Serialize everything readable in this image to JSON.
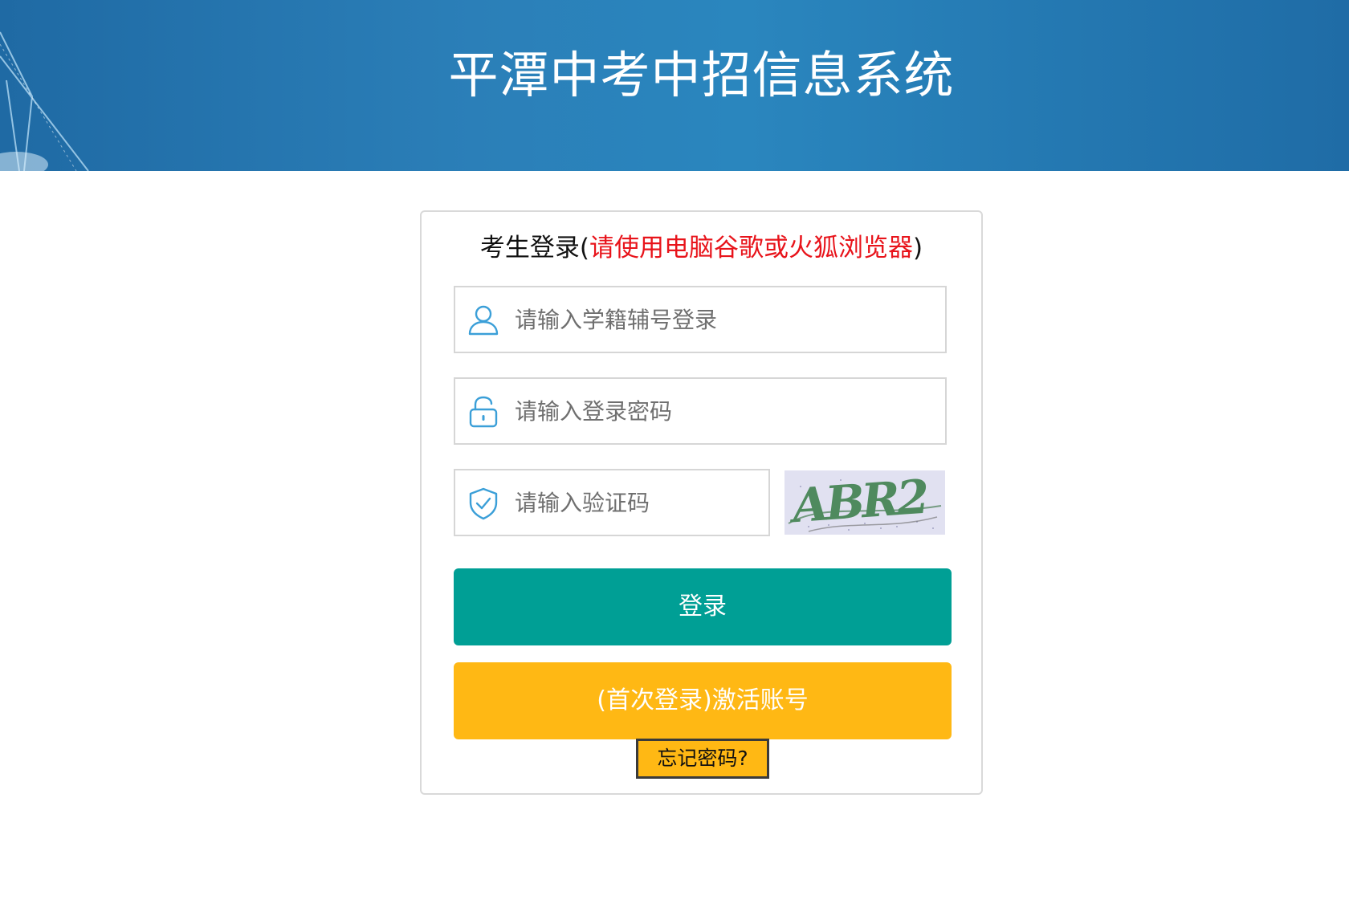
{
  "header": {
    "title": "平潭中考中招信息系统"
  },
  "login_panel": {
    "title_prefix": "考生登录(",
    "title_warning": "请使用电脑谷歌或火狐浏览器",
    "title_suffix": ")",
    "username": {
      "placeholder": "请输入学籍辅号登录",
      "value": "",
      "icon": "user-icon"
    },
    "password": {
      "placeholder": "请输入登录密码",
      "value": "",
      "icon": "lock-icon"
    },
    "captcha": {
      "placeholder": "请输入验证码",
      "value": "",
      "icon": "shield-check-icon",
      "image_text": "ABR2"
    },
    "login_button": "登录",
    "activate_button": "(首次登录)激活账号",
    "forgot_link": "忘记密码?"
  },
  "colors": {
    "header_bg": "#2a7fb8",
    "login_button": "#009f95",
    "activate_button": "#ffb814",
    "warning_text": "#e8141b",
    "icon": "#3b9fd8"
  }
}
